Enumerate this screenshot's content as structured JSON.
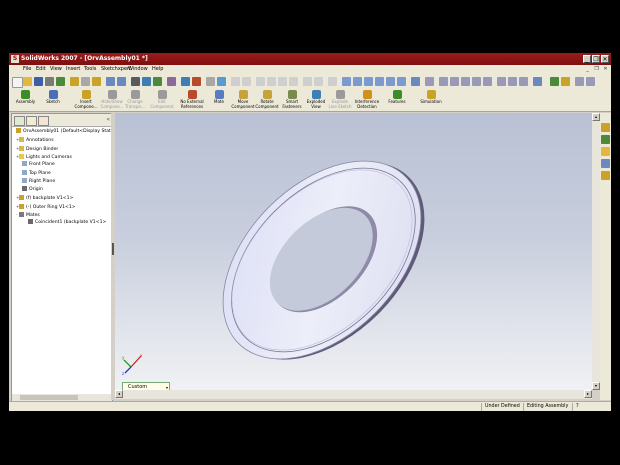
{
  "window": {
    "title": "SolidWorks 2007 - [OrvAssembly01 *]",
    "logo": "S",
    "controls": [
      "_",
      "❐",
      "✕"
    ]
  },
  "menu": {
    "items": [
      "File",
      "Edit",
      "View",
      "Insert",
      "Tools",
      "Sketchxpert",
      "Window",
      "Help"
    ],
    "doc_controls": [
      "_",
      "❐",
      "✕"
    ]
  },
  "command_manager": {
    "items": [
      {
        "label": "Assembly",
        "icon": "assembly-icon",
        "color": "#3b8d2a",
        "dim": false
      },
      {
        "label": "Sketch",
        "icon": "sketch-icon",
        "color": "#4a6fb5",
        "dim": false
      },
      {
        "label": "Insert Compone...",
        "icon": "insert-component-icon",
        "color": "#c9a227",
        "dim": false
      },
      {
        "label": "Hide/Show Compone...",
        "icon": "hide-show-components-icon",
        "color": "#9a9a9a",
        "dim": true
      },
      {
        "label": "Change Transpa...",
        "icon": "change-transparency-icon",
        "color": "#9a9a9a",
        "dim": true
      },
      {
        "label": "Edit Component",
        "icon": "edit-component-icon",
        "color": "#9a9a9a",
        "dim": true
      },
      {
        "label": "No External References",
        "icon": "no-external-references-icon",
        "color": "#b94a2c",
        "dim": false
      },
      {
        "label": "Mate",
        "icon": "mate-icon",
        "color": "#5a7bbf",
        "dim": false
      },
      {
        "label": "Move Component",
        "icon": "move-component-icon",
        "color": "#c6a23a",
        "dim": false
      },
      {
        "label": "Rotate Component",
        "icon": "rotate-component-icon",
        "color": "#c6a23a",
        "dim": false
      },
      {
        "label": "Smart Fasteners",
        "icon": "smart-fasteners-icon",
        "color": "#7a8a4a",
        "dim": false
      },
      {
        "label": "Exploded View",
        "icon": "exploded-view-icon",
        "color": "#3d7fb5",
        "dim": false
      },
      {
        "label": "Explode Line Sketch",
        "icon": "explode-line-sketch-icon",
        "color": "#9a9a9a",
        "dim": true
      },
      {
        "label": "Interference Detection",
        "icon": "interference-detection-icon",
        "color": "#d09020",
        "dim": false
      },
      {
        "label": "Features",
        "icon": "features-icon",
        "color": "#3b8d2a",
        "dim": false
      },
      {
        "label": "Simulation",
        "icon": "simulation-icon",
        "color": "#c9a227",
        "dim": false
      }
    ]
  },
  "feature_manager": {
    "tree": [
      {
        "label": "OrvAssembly01  (Default<Display Stat",
        "icon": "assembly-icon",
        "color": "#c9a227",
        "toggle": ""
      },
      {
        "label": "Annotations",
        "icon": "annotations-icon",
        "color": "#d9b84a",
        "toggle": "+"
      },
      {
        "label": "Design Binder",
        "icon": "design-binder-icon",
        "color": "#d9b84a",
        "toggle": "+"
      },
      {
        "label": "Lights and Cameras",
        "icon": "lights-cameras-icon",
        "color": "#e6c84a",
        "toggle": "+"
      },
      {
        "label": "Front Plane",
        "icon": "plane-icon",
        "color": "#8fa8c8",
        "toggle": ""
      },
      {
        "label": "Top Plane",
        "icon": "plane-icon",
        "color": "#8fa8c8",
        "toggle": ""
      },
      {
        "label": "Right Plane",
        "icon": "plane-icon",
        "color": "#8fa8c8",
        "toggle": ""
      },
      {
        "label": "Origin",
        "icon": "origin-icon",
        "color": "#6a6a6a",
        "toggle": ""
      },
      {
        "label": "(f) backplate V1<1>",
        "icon": "part-icon",
        "color": "#c9a227",
        "toggle": "+"
      },
      {
        "label": "(-) Outer Ring V1<1>",
        "icon": "part-icon",
        "color": "#c9a227",
        "toggle": "+"
      },
      {
        "label": "Mates",
        "icon": "mates-icon",
        "color": "#7a7a7a",
        "toggle": "-"
      },
      {
        "label": "Coincident1 (backplate V1<1>",
        "icon": "coincident-icon",
        "color": "#6a6a6a",
        "toggle": ""
      }
    ]
  },
  "viewport": {
    "view_orientation": "Custom",
    "triad": {
      "x": "x",
      "y": "y",
      "z": "z"
    }
  },
  "status_bar": {
    "defined_state": "Under Defined",
    "mode": "Editing Assembly",
    "help_icon": "?"
  },
  "colors": {
    "titlebar": "#8a1515",
    "part_face": "#e4e6f8",
    "part_edge": "#6e6a88",
    "viewport_top": "#b9c1d4",
    "viewport_bottom": "#f0f1f4"
  }
}
